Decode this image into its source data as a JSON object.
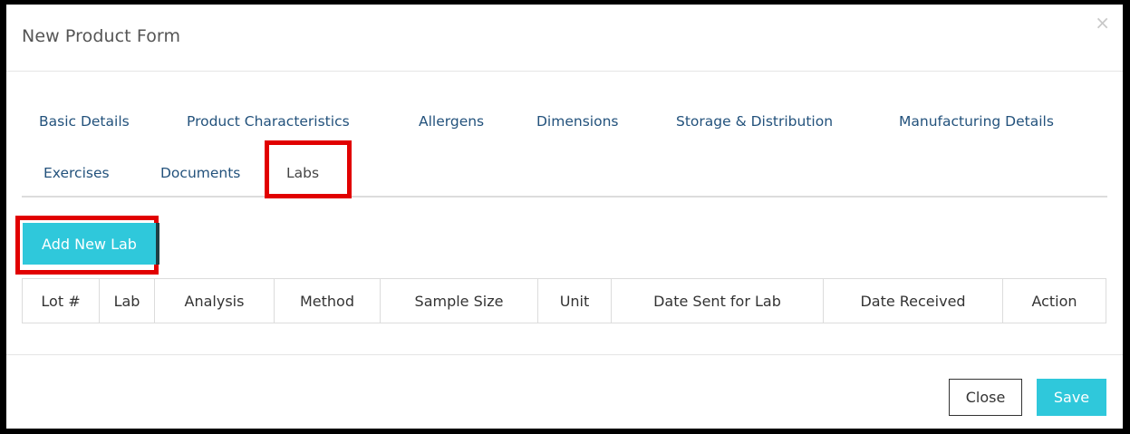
{
  "modal": {
    "title": "New Product Form",
    "close_icon": "×"
  },
  "tabs": [
    {
      "label": "Basic Details",
      "active": false
    },
    {
      "label": "Product Characteristics",
      "active": false
    },
    {
      "label": "Allergens",
      "active": false
    },
    {
      "label": "Dimensions",
      "active": false
    },
    {
      "label": "Storage & Distribution",
      "active": false
    },
    {
      "label": "Manufacturing Details",
      "active": false
    },
    {
      "label": "Exercises",
      "active": false
    },
    {
      "label": "Documents",
      "active": false
    },
    {
      "label": "Labs",
      "active": true
    }
  ],
  "labs": {
    "add_button_label": "Add New Lab",
    "columns": [
      "Lot #",
      "Lab",
      "Analysis",
      "Method",
      "Sample Size",
      "Unit",
      "Date Sent for Lab",
      "Date Received",
      "Action"
    ]
  },
  "footer": {
    "close_label": "Close",
    "save_label": "Save"
  },
  "colors": {
    "accent": "#2fc8db",
    "link": "#23527c",
    "highlight": "#e10000"
  }
}
